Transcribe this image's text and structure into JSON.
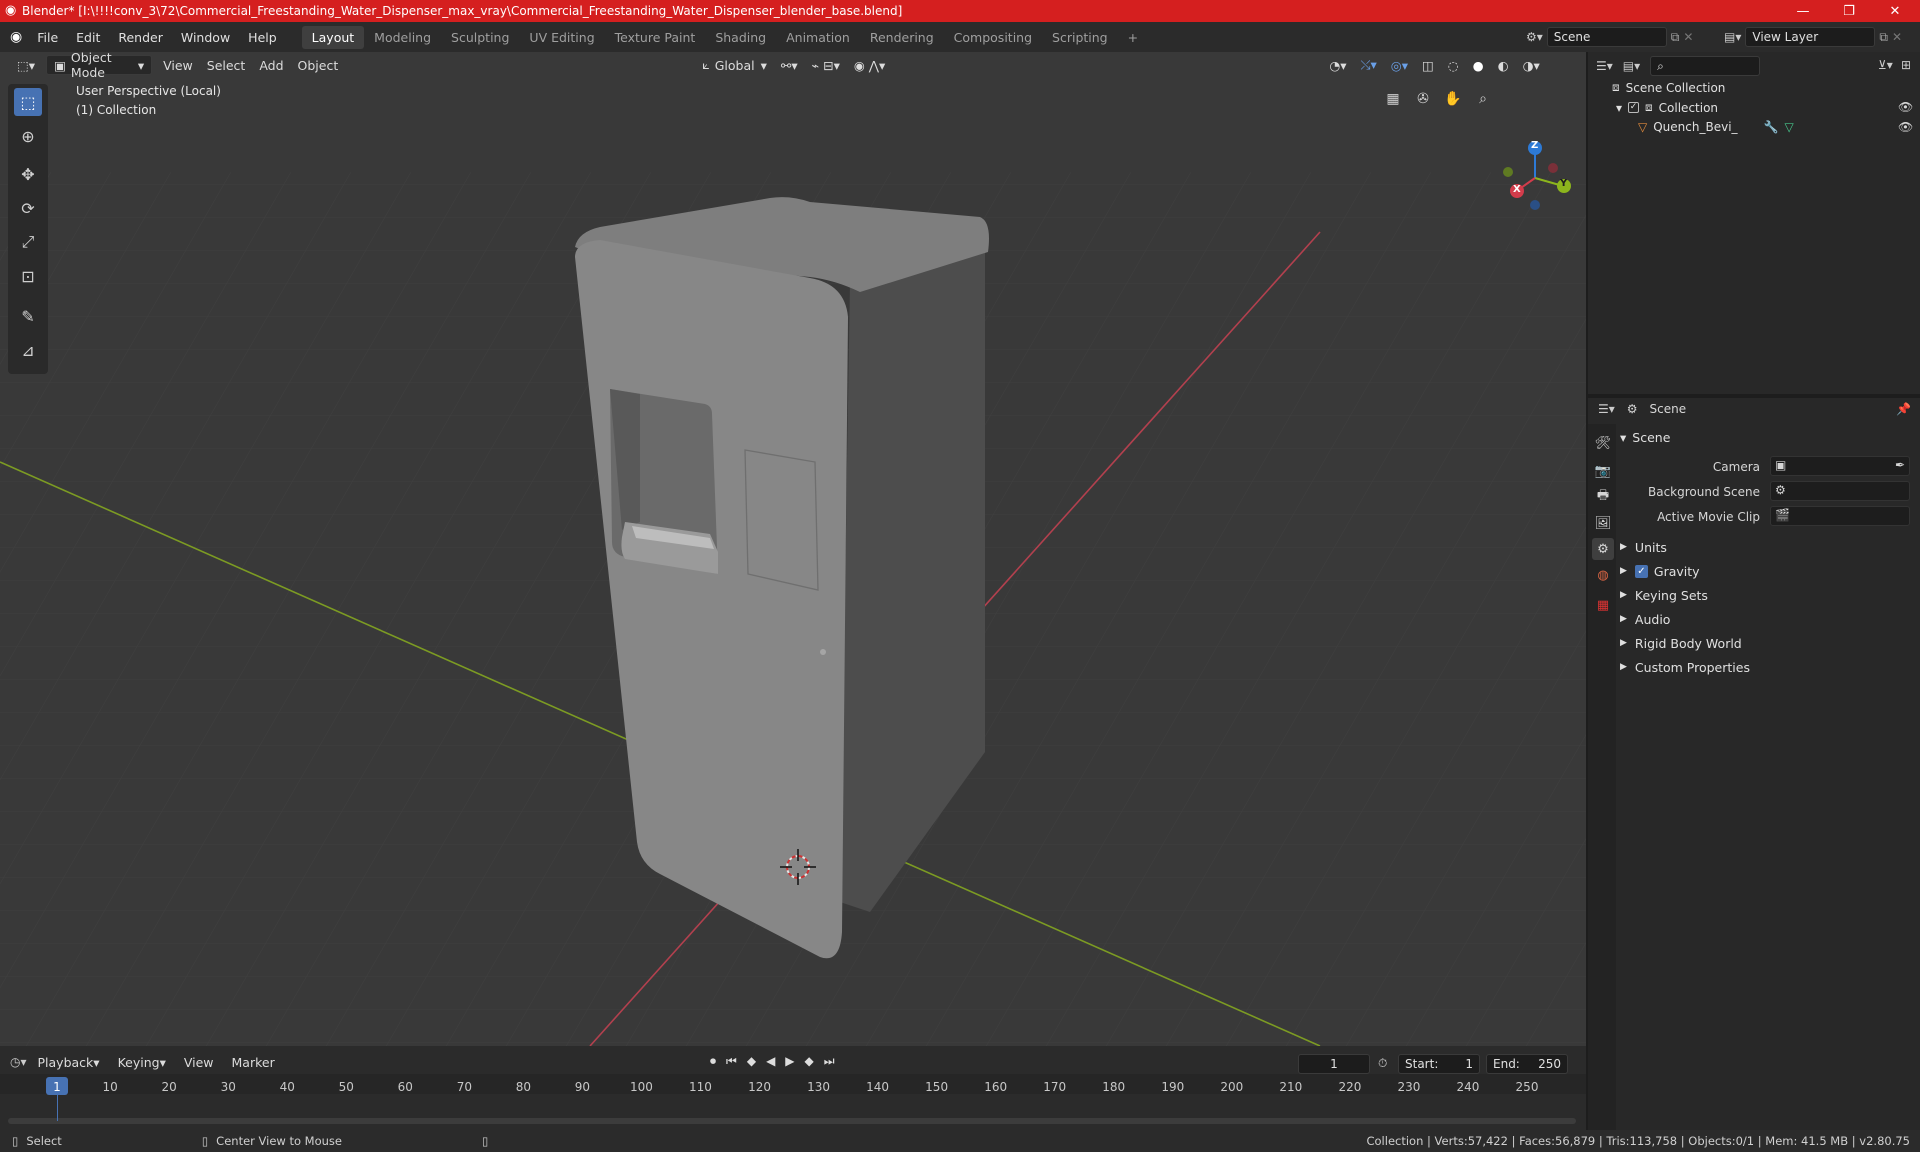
{
  "window": {
    "title": "Blender* [I:\\!!!!conv_3\\72\\Commercial_Freestanding_Water_Dispenser_max_vray\\Commercial_Freestanding_Water_Dispenser_blender_base.blend]",
    "controls": [
      "—",
      "❐",
      "✕"
    ]
  },
  "menu": {
    "items": [
      "File",
      "Edit",
      "Render",
      "Window",
      "Help"
    ],
    "workspaces": [
      "Layout",
      "Modeling",
      "Sculpting",
      "UV Editing",
      "Texture Paint",
      "Shading",
      "Animation",
      "Rendering",
      "Compositing",
      "Scripting"
    ],
    "active_workspace": "Layout",
    "add_tab": "+",
    "scene_name": "Scene",
    "view_layer": "View Layer"
  },
  "viewport": {
    "mode": "Object Mode",
    "menus": [
      "View",
      "Select",
      "Add",
      "Object"
    ],
    "transform_orientation": "Global",
    "overlay_title": "User Perspective (Local)",
    "overlay_collection": "(1) Collection",
    "gizmo_axes": {
      "x": "X",
      "y": "Y",
      "z": "Z"
    }
  },
  "outliner": {
    "search_placeholder": "",
    "root": "Scene Collection",
    "collection": "Collection",
    "object": "Quench_Bevi_"
  },
  "properties": {
    "header": "Scene",
    "panel_title": "Scene",
    "camera_label": "Camera",
    "background_scene_label": "Background Scene",
    "active_movie_clip_label": "Active Movie Clip",
    "sections": [
      "Units",
      "Gravity",
      "Keying Sets",
      "Audio",
      "Rigid Body World",
      "Custom Properties"
    ],
    "gravity_checked": true
  },
  "timeline": {
    "menus": [
      "Playback",
      "Keying",
      "View",
      "Marker"
    ],
    "current_frame": "1",
    "start_label": "Start:",
    "start": "1",
    "end_label": "End:",
    "end": "250",
    "ruler": [
      "1",
      "10",
      "20",
      "30",
      "40",
      "50",
      "60",
      "70",
      "80",
      "90",
      "100",
      "110",
      "120",
      "130",
      "140",
      "150",
      "160",
      "170",
      "180",
      "190",
      "200",
      "210",
      "220",
      "230",
      "240",
      "250"
    ]
  },
  "status": {
    "select": "Select",
    "center_view": "Center View to Mouse",
    "stats": "Collection | Verts:57,422 | Faces:56,879 | Tris:113,758 | Objects:0/1 | Mem: 41.5 MB | v2.80.75"
  },
  "colors": {
    "title_bar": "#d51f1f",
    "accent": "#4772b3",
    "x_axis": "#d33c4b",
    "y_axis": "#8cb51d",
    "z_axis": "#2d7ad6"
  }
}
